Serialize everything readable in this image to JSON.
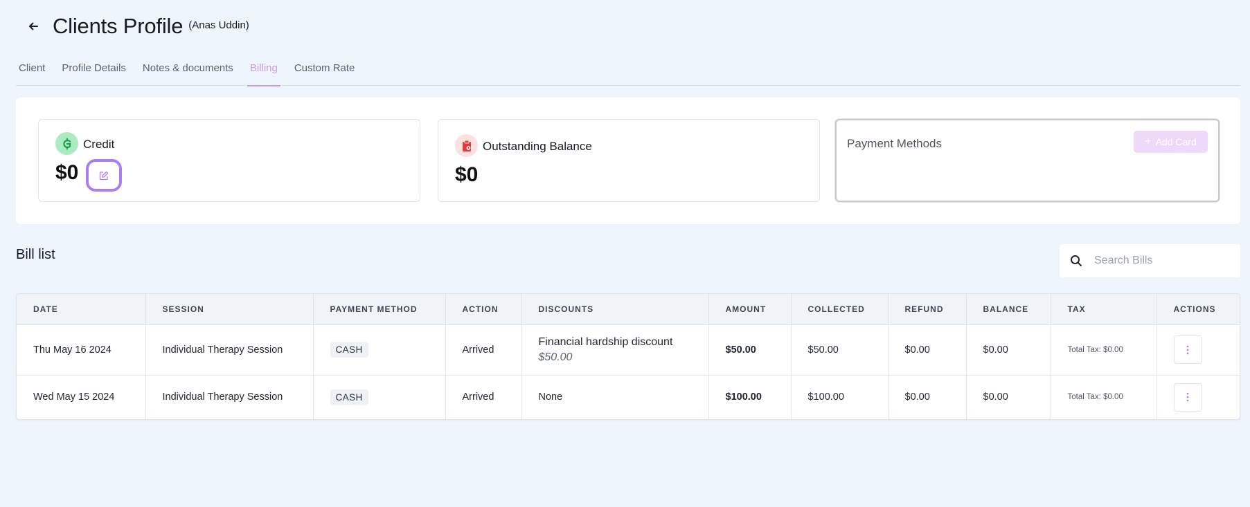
{
  "header": {
    "title": "Clients Profile",
    "client_name": "(Anas Uddin)"
  },
  "tabs": [
    {
      "label": "Client",
      "active": false
    },
    {
      "label": "Profile Details",
      "active": false
    },
    {
      "label": "Notes & documents",
      "active": false
    },
    {
      "label": "Billing",
      "active": true
    },
    {
      "label": "Custom Rate",
      "active": false
    }
  ],
  "summary": {
    "credit": {
      "label": "Credit",
      "amount": "$0"
    },
    "outstanding": {
      "label": "Outstanding Balance",
      "amount": "$0"
    },
    "payment_methods": {
      "title": "Payment Methods",
      "add_card_label": "Add Card"
    }
  },
  "bill_list": {
    "title": "Bill list",
    "search_placeholder": "Search Bills",
    "columns": [
      "DATE",
      "SESSION",
      "PAYMENT METHOD",
      "ACTION",
      "DISCOUNTS",
      "AMOUNT",
      "COLLECTED",
      "REFUND",
      "BALANCE",
      "TAX",
      "ACTIONS"
    ],
    "rows": [
      {
        "date": "Thu May 16 2024",
        "session": "Individual Therapy Session",
        "payment_method": "CASH",
        "action": "Arrived",
        "discount_name": "Financial hardship discount",
        "discount_amount": "$50.00",
        "amount": "$50.00",
        "collected": "$50.00",
        "refund": "$0.00",
        "balance": "$0.00",
        "tax": "Total Tax: $0.00"
      },
      {
        "date": "Wed May 15 2024",
        "session": "Individual Therapy Session",
        "payment_method": "CASH",
        "action": "Arrived",
        "discount_name": "None",
        "discount_amount": "",
        "amount": "$100.00",
        "collected": "$100.00",
        "refund": "$0.00",
        "balance": "$0.00",
        "tax": "Total Tax: $0.00"
      }
    ]
  },
  "colors": {
    "background": "#eef5fd",
    "accent_active_tab": "#c79be6",
    "edit_focus_ring": "#a97ef0",
    "add_card_disabled": "#efd9fb",
    "credit_icon_bg": "#a9ecc0",
    "outstanding_icon_bg": "#fde0e0"
  },
  "icons": {
    "back": "arrow-left-icon",
    "credit": "currency-icon",
    "outstanding": "clipboard-icon",
    "edit": "edit-icon",
    "search": "search-icon",
    "row_actions": "kebab-menu-icon"
  }
}
